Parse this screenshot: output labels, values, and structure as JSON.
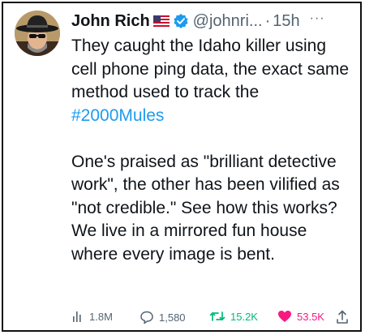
{
  "tweet": {
    "author_name": "John Rich",
    "handle": "@johnri...",
    "separator": "·",
    "time": "15h",
    "more_label": "···",
    "text_line1": "They caught the Idaho killer using cell phone ping data, the exact same method used to track the ",
    "hashtag": "#2000Mules",
    "text_para2": "One's praised as \"brilliant detective work\", the other has been vilified as \"not credible.\" See how this works? We live in a mirrored fun house where every image is bent."
  },
  "stats": {
    "views": "1.8M",
    "replies": "1,580",
    "retweets": "15.2K",
    "likes": "53.5K"
  },
  "colors": {
    "hashtag": "#1d9bf0",
    "verified": "#1d9bf0",
    "retweet": "#00ba7c",
    "like": "#f91880",
    "muted": "#536471"
  },
  "icons": [
    "user-avatar",
    "us-flag-icon",
    "verified-badge-icon",
    "more-options-icon",
    "views-chart-icon",
    "reply-icon",
    "retweet-icon",
    "like-heart-icon",
    "share-icon"
  ]
}
